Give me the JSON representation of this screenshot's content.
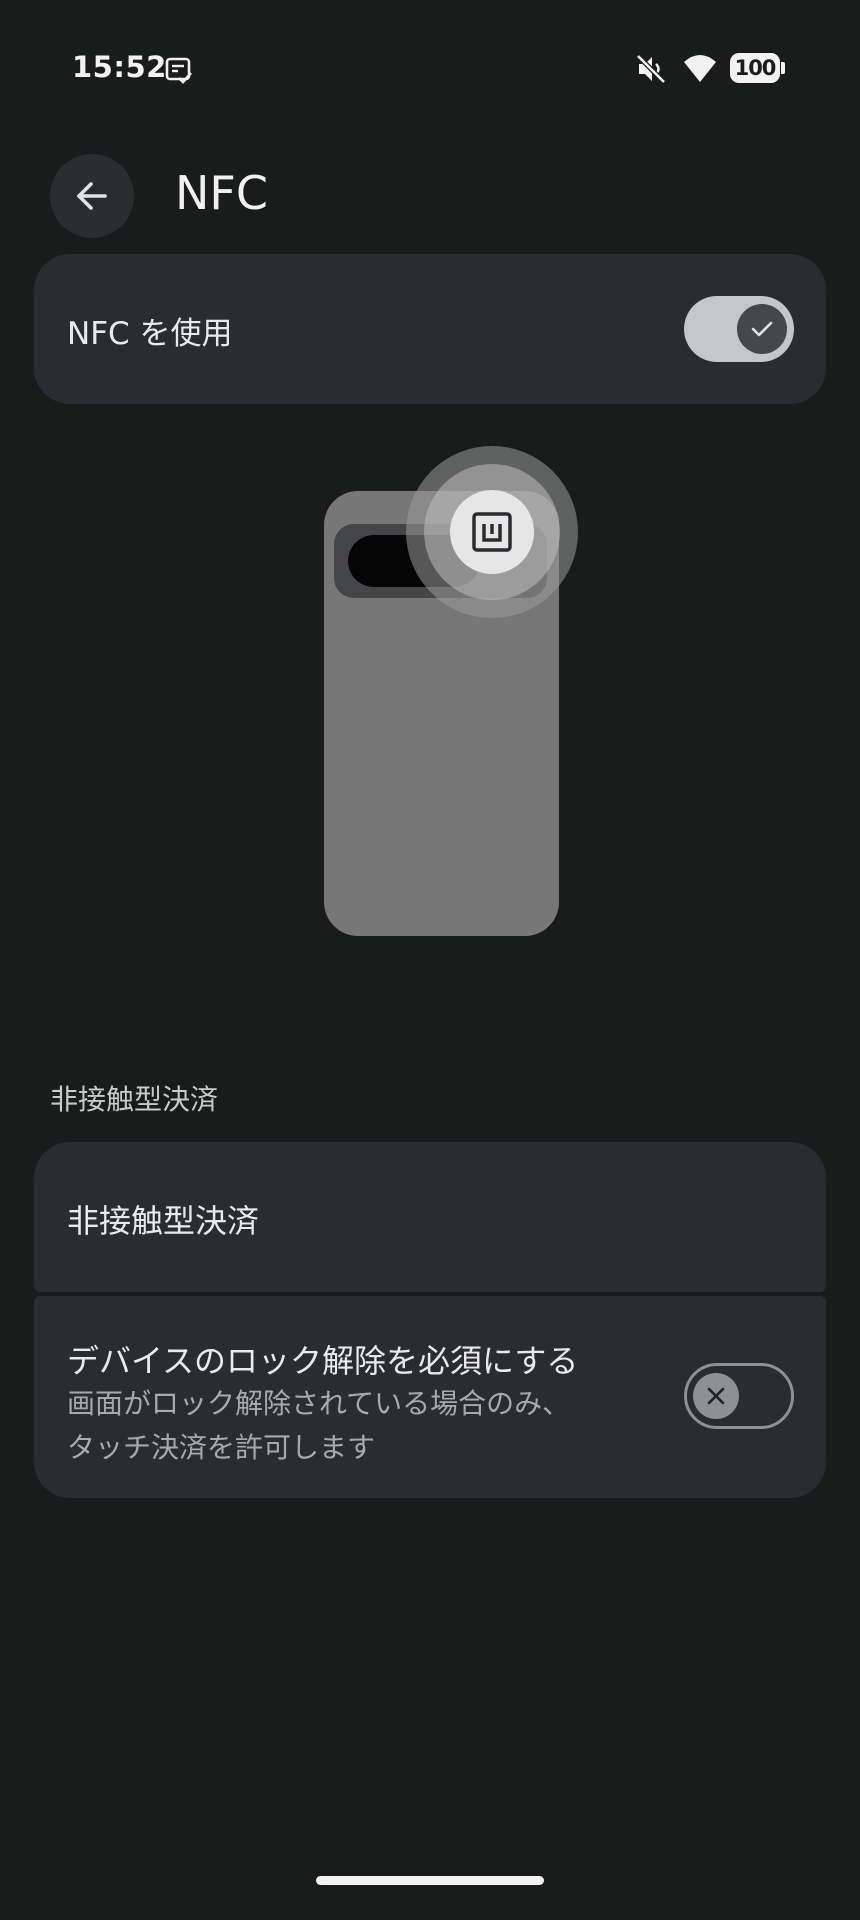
{
  "status_bar": {
    "time": "15:52",
    "battery": "100",
    "icons": [
      "notification-icon",
      "mute-icon",
      "wifi-icon",
      "battery-icon"
    ]
  },
  "header": {
    "back_icon": "arrow-back-icon",
    "title": "NFC"
  },
  "nfc_toggle": {
    "label": "NFC を使用",
    "checked": true
  },
  "illustration": {
    "icon": "nfc-icon"
  },
  "contactless": {
    "section_title": "非接触型決済",
    "payments_label": "非接触型決済",
    "require_unlock": {
      "label": "デバイスのロック解除を必須にする",
      "desc_line1": "画面がロック解除されている場合のみ、",
      "desc_line2": "タッチ決済を許可します",
      "checked": false
    }
  },
  "colors": {
    "background": "#1a1c1c",
    "card": "#2a2d2f",
    "toggle_on_track": "#c4c7c9",
    "toggle_off": "#8e9193"
  }
}
